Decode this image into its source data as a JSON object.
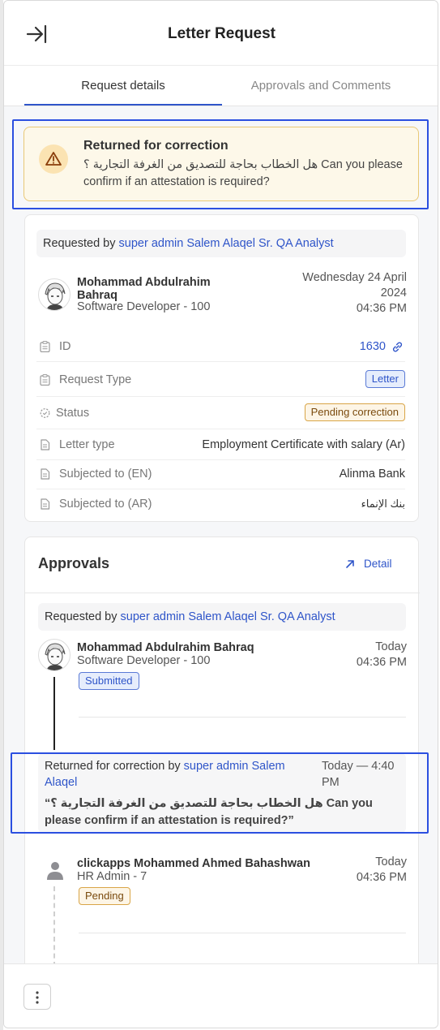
{
  "header": {
    "title": "Letter Request",
    "collapse_icon": "collapse-right-icon"
  },
  "tabs": [
    {
      "label": "Request details",
      "active": true
    },
    {
      "label": "Approvals and Comments",
      "active": false
    }
  ],
  "banner": {
    "title": "Returned for correction",
    "message": "هل الخطاب بحاجة للتصديق من الغرفة التجارية ؟ Can you please confirm if an attestation is required?",
    "icon": "warning-icon"
  },
  "request": {
    "requested_by_prefix": "Requested by",
    "requested_by_name": "super admin Salem Alaqel Sr. QA Analyst",
    "person_name": "Mohammad Abdulrahim Bahraq",
    "person_role": "Software Developer - 100",
    "date_line1": "Wednesday 24 April",
    "date_line2": "2024",
    "time": "04:36 PM",
    "fields": [
      {
        "label": "ID",
        "value": "1630",
        "icon": "clipboard-icon"
      },
      {
        "label": "Request Type",
        "value": "Letter",
        "icon": "clipboard-icon"
      },
      {
        "label": "Status",
        "value": "Pending correction",
        "icon": "status-dashed-circle-icon"
      },
      {
        "label": "Letter type",
        "value": "Employment Certificate with salary (Ar)",
        "icon": "document-icon"
      },
      {
        "label": "Subjected to (EN)",
        "value": "Alinma Bank",
        "icon": "document-icon"
      },
      {
        "label": "Subjected to (AR)",
        "value": "بنك الإنماء",
        "icon": "document-icon"
      }
    ]
  },
  "approvals": {
    "title": "Approvals",
    "detail_label": "Detail",
    "requested_by_prefix": "Requested by",
    "requested_by_name": "super admin Salem Alaqel Sr. QA Analyst",
    "step1": {
      "name": "Mohammad Abdulrahim Bahraq",
      "role": "Software Developer - 100",
      "date": "Today",
      "time": "04:36 PM",
      "badge": "Submitted"
    },
    "returned": {
      "prefix": "Returned for correction by",
      "name": "super admin Salem Alaqel",
      "date": "Today — 4:40 PM",
      "comment": "“هل الخطاب بحاجة للتصديق من الغرفة التجارية ؟ Can you please confirm if an attestation is required?”"
    },
    "step2": {
      "name": "clickapps Mohammed Ahmed Bahashwan",
      "role": "HR Admin - 7",
      "date": "Today",
      "time": "04:36 PM",
      "badge": "Pending"
    }
  },
  "colors": {
    "accent": "#2f55c9",
    "warning_bg": "#fdf8e9",
    "warning_border": "#e9c876",
    "focus": "#2b4fe0"
  }
}
